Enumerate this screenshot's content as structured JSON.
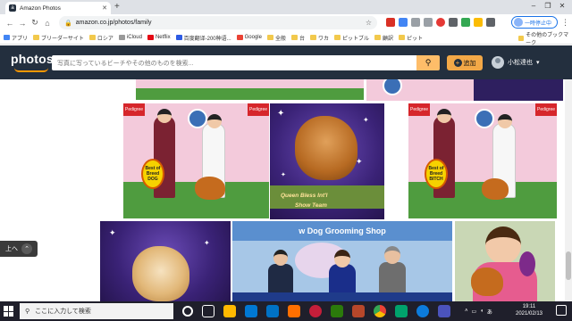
{
  "browser": {
    "tab_title": "Amazon Photos",
    "url": "amazon.co.jp/photos/family",
    "pause_label": "一時停止中",
    "bookmarks": [
      "アプリ",
      "ブリーダーサイト",
      "ロシア",
      "iCloud",
      "Netflix",
      "百度翻译-200种语...",
      "Google",
      "全般",
      "台",
      "ワカ",
      "ピットブル",
      "顧訳",
      "ピット"
    ],
    "other_bookmarks": "その他のブックマーク"
  },
  "header": {
    "logo": "photos",
    "search_placeholder": "写真に写っているビーチやその他のものを検索...",
    "add_label": "追加",
    "user_name": "小松達也"
  },
  "photos": {
    "captions": [
      "Queen Bless Int'l",
      "Show Team"
    ],
    "sign_text": [
      "Best of",
      "Breed",
      "DOG"
    ],
    "sign_text_2": [
      "Best of",
      "Breed",
      "BITCH"
    ],
    "banner_label": "Pedigree",
    "shop_text": "w Dog Grooming Shop"
  },
  "scroll_to_top": "上へ",
  "taskbar": {
    "search_placeholder": "ここに入力して検索",
    "ime": "あ",
    "time": "19:11",
    "date": "2021/02/13"
  }
}
